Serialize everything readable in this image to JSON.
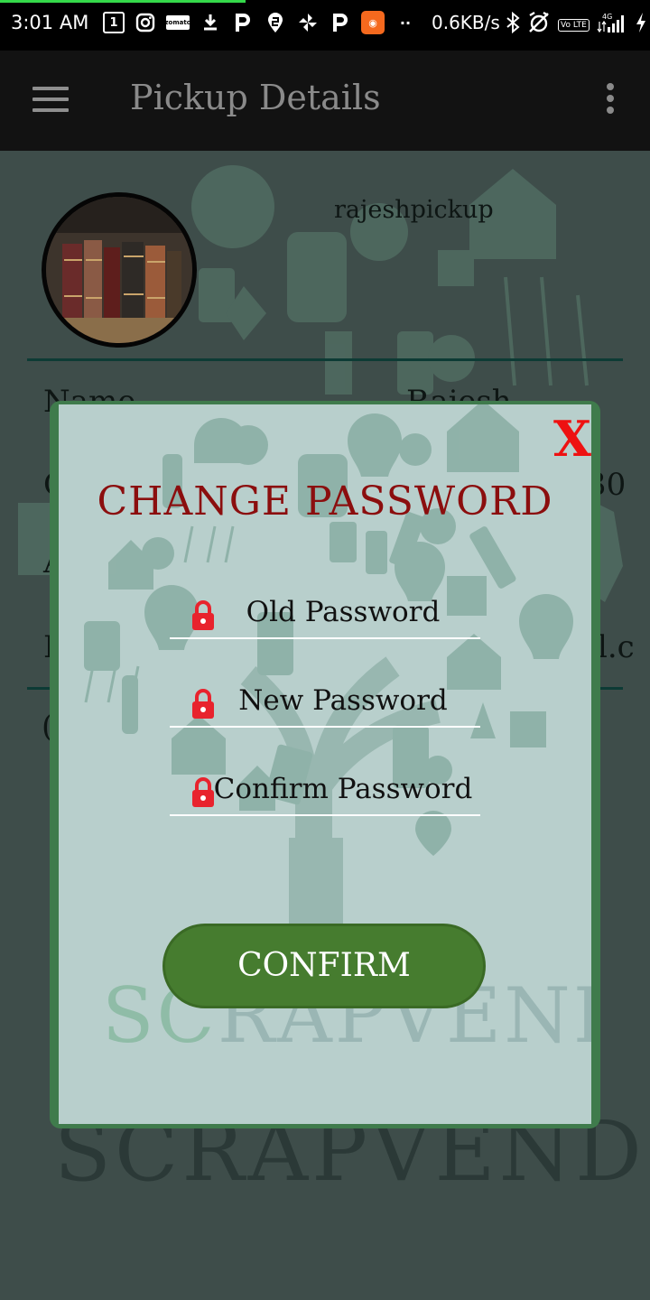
{
  "status_bar": {
    "time": "3:01 AM",
    "calendar_day": "1",
    "zomato_label": "zomato",
    "network_speed": "0.6KB/s",
    "volte_label": "Vo LTE",
    "signal_label": "4G"
  },
  "toolbar": {
    "title": "Pickup Details"
  },
  "profile": {
    "username": "rajeshpickup",
    "name_label": "Name",
    "name_value": "Rajesh",
    "edge_row2_left": "C",
    "edge_row2_right": "30",
    "edge_row3_left": "A",
    "edge_row4_left": "E",
    "edge_row4_right": "l.c",
    "edge_row5_left": "("
  },
  "dialog": {
    "close_label": "X",
    "title": "CHANGE PASSWORD",
    "old_password_placeholder": "Old Password",
    "new_password_placeholder": "New Password",
    "confirm_password_placeholder": "Confirm Password",
    "confirm_button": "CONFIRM",
    "watermark_part1": "SC",
    "watermark_part2": "RAPVEND"
  },
  "background_watermark": "SCRAPVEND",
  "colors": {
    "dialog_title": "#8b0e0e",
    "close_x": "#ee1111",
    "confirm_button": "#467c2f",
    "lock_icon": "#e8232d",
    "dialog_border": "#3f7b4c"
  }
}
